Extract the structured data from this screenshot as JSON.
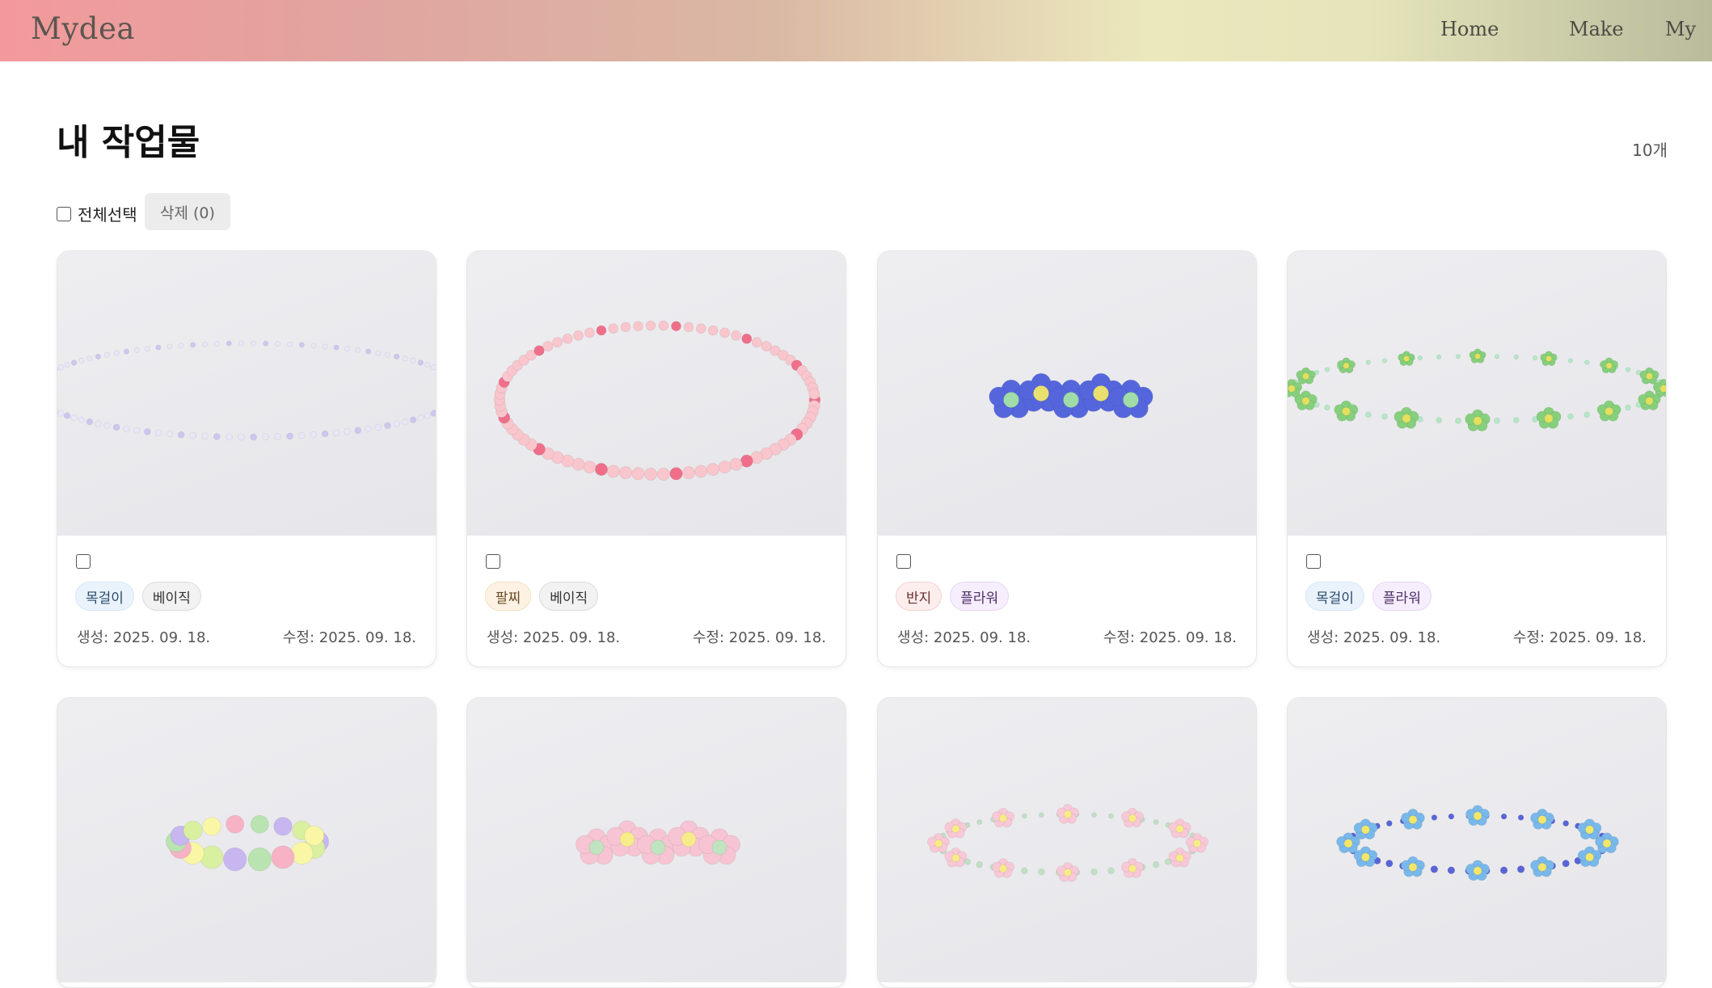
{
  "brand": "Mydea",
  "nav": [
    "Home",
    "Make",
    "My"
  ],
  "page": {
    "title": "내 작업물",
    "count": "10개"
  },
  "toolbar": {
    "select_all_label": "전체선택",
    "delete_label": "삭제 (0)"
  },
  "cards": [
    {
      "tags": [
        "목걸이",
        "베이직"
      ],
      "created": "생성: 2025. 09. 18.",
      "modified": "수정: 2025. 09. 18."
    },
    {
      "tags": [
        "팔찌",
        "베이직"
      ],
      "created": "생성: 2025. 09. 18.",
      "modified": "수정: 2025. 09. 18."
    },
    {
      "tags": [
        "반지",
        "플라워"
      ],
      "created": "생성: 2025. 09. 18.",
      "modified": "수정: 2025. 09. 18."
    },
    {
      "tags": [
        "목걸이",
        "플라워"
      ],
      "created": "생성: 2025. 09. 18.",
      "modified": "수정: 2025. 09. 18."
    },
    {
      "tags": [],
      "created": "",
      "modified": ""
    },
    {
      "tags": [],
      "created": "",
      "modified": ""
    },
    {
      "tags": [],
      "created": "",
      "modified": ""
    },
    {
      "tags": [],
      "created": "",
      "modified": ""
    }
  ],
  "colors": {
    "header_gradient_start": "#f3999b",
    "header_gradient_mid": "#ebe8bd",
    "header_gradient_end": "#b9bb9c",
    "tag_necklace": "#eaf3fc",
    "tag_bracelet": "#fdf2e4",
    "tag_ring": "#fdeeee",
    "tag_flower": "#f6eefc",
    "tag_basic": "#f2f2f3"
  }
}
